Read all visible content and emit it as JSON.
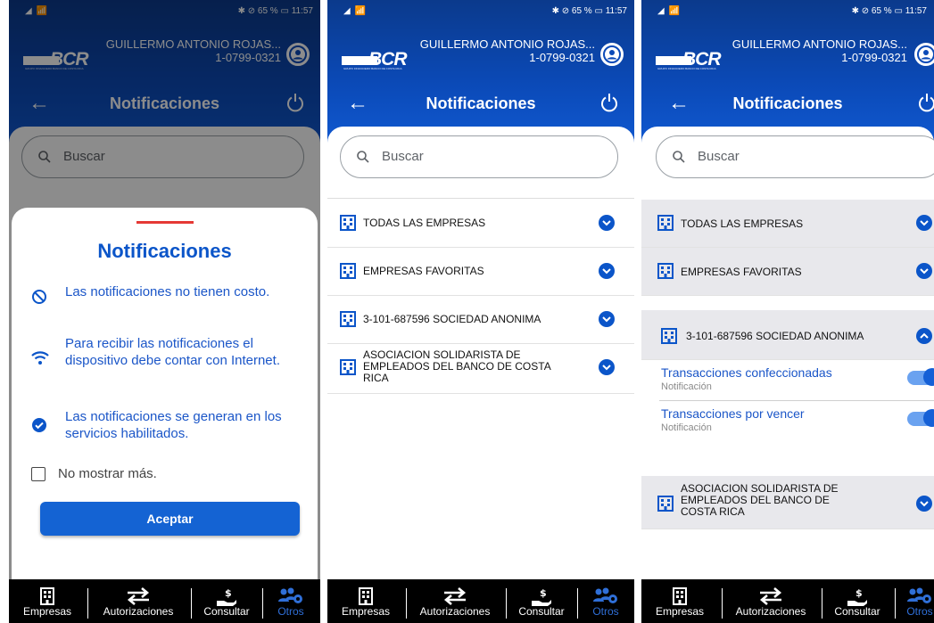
{
  "status": {
    "signal": "◢ 📶",
    "right": "✱ ⊘ 65 % ▭ 11:57"
  },
  "brand": {
    "logo": "BCR",
    "tagline": "GRUPO FINANCIERO BANCO DE COSTA RICA"
  },
  "user": {
    "name": "GUILLERMO ANTONIO ROJAS...",
    "id": "1-0799-0321"
  },
  "nav": {
    "title": "Notificaciones"
  },
  "search": {
    "placeholder": "Buscar"
  },
  "companies": [
    {
      "label": "TODAS LAS EMPRESAS"
    },
    {
      "label": "EMPRESAS FAVORITAS"
    },
    {
      "label": "3-101-687596 SOCIEDAD ANONIMA"
    },
    {
      "label": "ASOCIACION SOLIDARISTA DE EMPLEADOS DEL BANCO DE COSTA RICA"
    }
  ],
  "expanded": {
    "items": [
      {
        "title": "Transacciones confeccionadas",
        "subtitle": "Notificación",
        "enabled": true
      },
      {
        "title": "Transacciones por vencer",
        "subtitle": "Notificación",
        "enabled": true
      }
    ]
  },
  "modal": {
    "title": "Notificaciones",
    "points": [
      "Las notificaciones no tienen costo.",
      "Para recibir las notificaciones el dispositivo debe contar con Internet.",
      "Las notificaciones se generan en los servicios habilitados."
    ],
    "checkbox": "No mostrar más.",
    "button": "Aceptar"
  },
  "bottom_nav": [
    "Empresas",
    "Autorizaciones",
    "Consultar",
    "Otros"
  ],
  "colors": {
    "primary": "#0b55c9",
    "header": "#0b4ab8",
    "accent": "#e53935"
  }
}
